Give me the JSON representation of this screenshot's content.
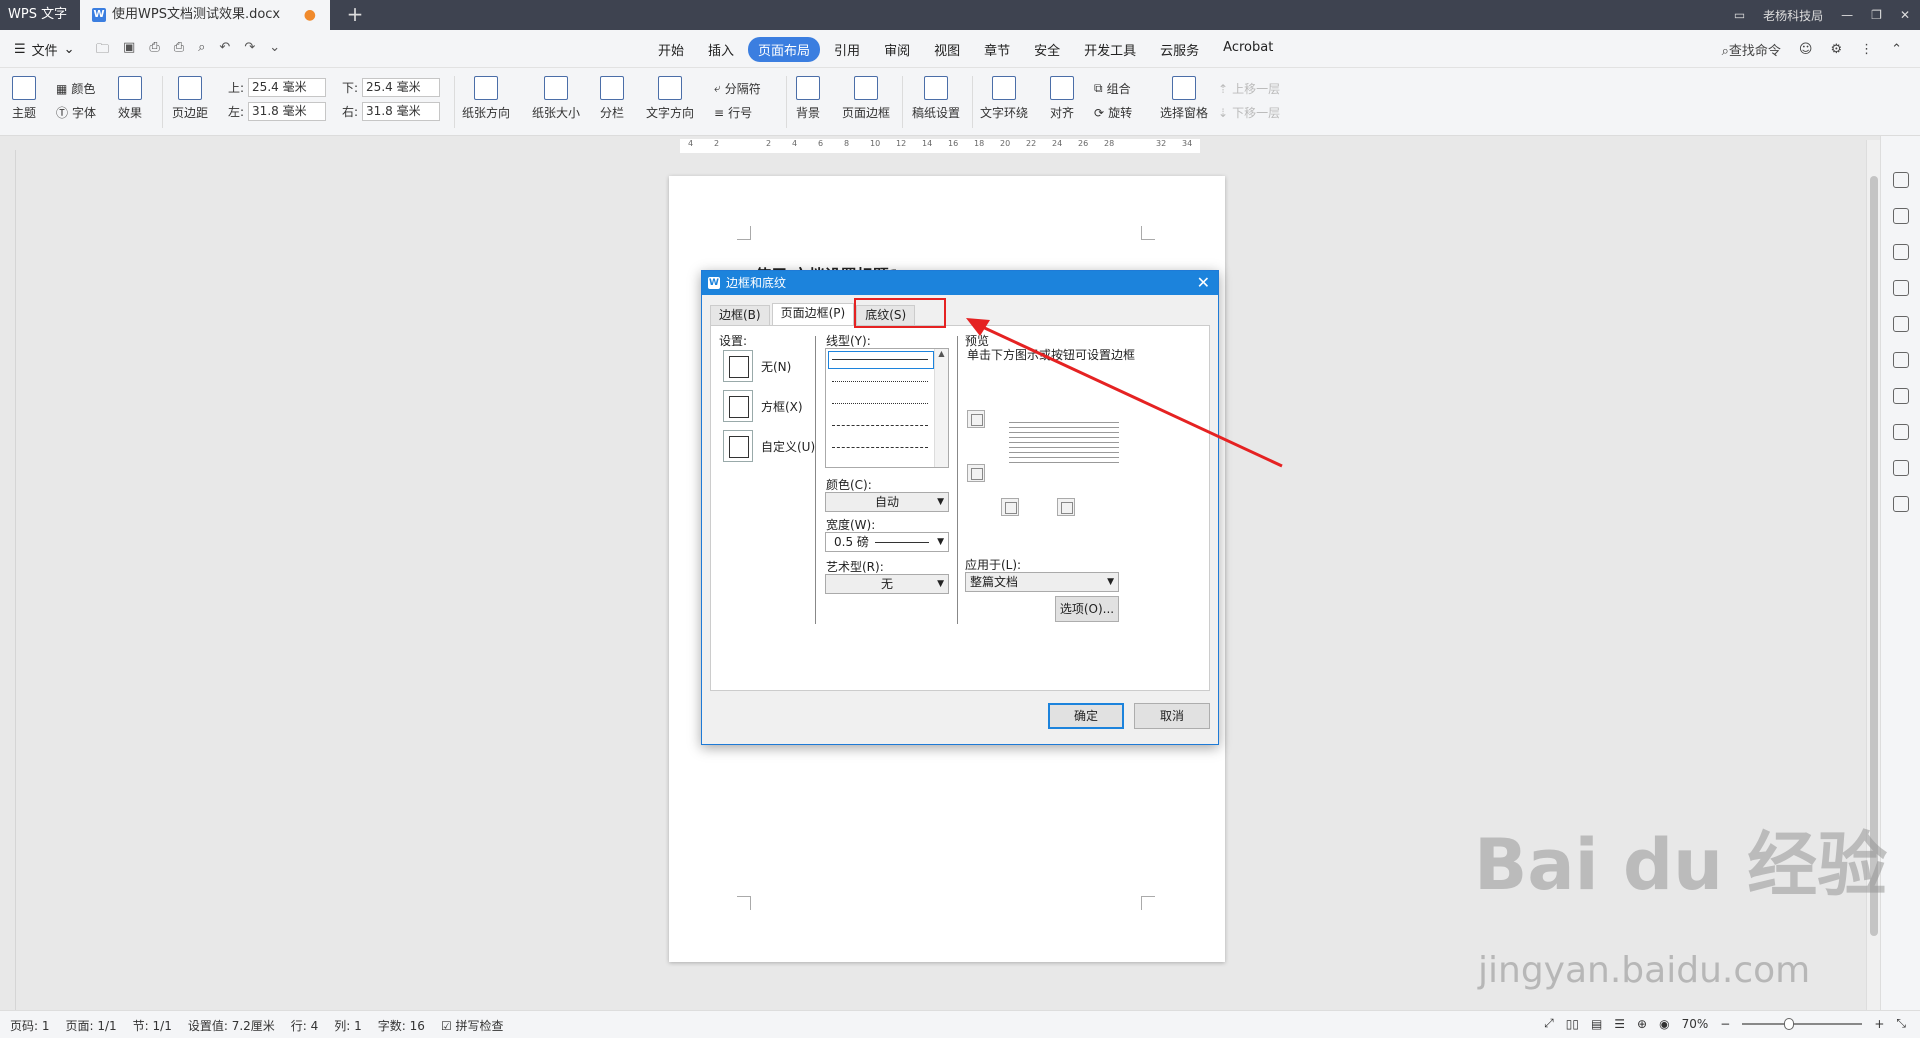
{
  "titlebar": {
    "app_name": "WPS 文字",
    "doc_tab": "使用WPS文档测试效果.docx",
    "user": "老杨科技局"
  },
  "menubar": {
    "file": "文件",
    "tabs": [
      "开始",
      "插入",
      "页面布局",
      "引用",
      "审阅",
      "视图",
      "章节",
      "安全",
      "开发工具",
      "云服务",
      "Acrobat"
    ],
    "active_tab": "页面布局",
    "search": "查找命令"
  },
  "ribbon": {
    "theme": "主题",
    "color": "颜色",
    "font": "字体",
    "effect": "效果",
    "margin": "页边距",
    "top_label": "上:",
    "top_value": "25.4 毫米",
    "bottom_label": "下:",
    "bottom_value": "25.4 毫米",
    "left_label": "左:",
    "left_value": "31.8 毫米",
    "right_label": "右:",
    "right_value": "31.8 毫米",
    "orientation": "纸张方向",
    "size": "纸张大小",
    "columns": "分栏",
    "text_direction": "文字方向",
    "separator": "分隔符",
    "line_number": "行号",
    "background": "背景",
    "page_border": "页面边框",
    "manuscript": "稿纸设置",
    "wrap": "文字环绕",
    "align": "对齐",
    "group": "组合",
    "rotate": "旋转",
    "select_pane": "选择窗格",
    "bring_forward": "上移一层",
    "send_backward": "下移一层"
  },
  "ruler": {
    "marks": [
      "4",
      "2",
      "2",
      "4",
      "6",
      "8",
      "10",
      "12",
      "14",
      "16",
      "18",
      "20",
      "22",
      "24",
      "26",
      "28",
      "32",
      "34"
    ]
  },
  "document": {
    "heading_partial": "使用    文档设置标题1"
  },
  "dialog": {
    "title": "边框和底纹",
    "tabs": [
      "边框(B)",
      "页面边框(P)",
      "底纹(S)"
    ],
    "settings_label": "设置:",
    "settings": [
      "无(N)",
      "方框(X)",
      "自定义(U)"
    ],
    "line_style_label": "线型(Y):",
    "color_label": "颜色(C):",
    "color_value": "自动",
    "width_label": "宽度(W):",
    "width_value": "0.5  磅",
    "art_label": "艺术型(R):",
    "art_value": "无",
    "preview_label": "预览",
    "preview_hint": "单击下方图示或按钮可设置边框",
    "apply_label": "应用于(L):",
    "apply_value": "整篇文档",
    "options_button": "选项(O)...",
    "ok_button": "确定",
    "cancel_button": "取消"
  },
  "statusbar": {
    "page": "页码: 1",
    "pages": "页面: 1/1",
    "section": "节: 1/1",
    "setting": "设置值: 7.2厘米",
    "row": "行: 4",
    "col": "列: 1",
    "words": "字数: 16",
    "spell": "拼写检查",
    "zoom": "70%"
  },
  "watermark": {
    "brand": "Bai du 经验",
    "url": "jingyan.baidu.com"
  },
  "colors": {
    "accent": "#3b7ee0",
    "dialog_title": "#1c83dc",
    "highlight": "#e52222"
  }
}
